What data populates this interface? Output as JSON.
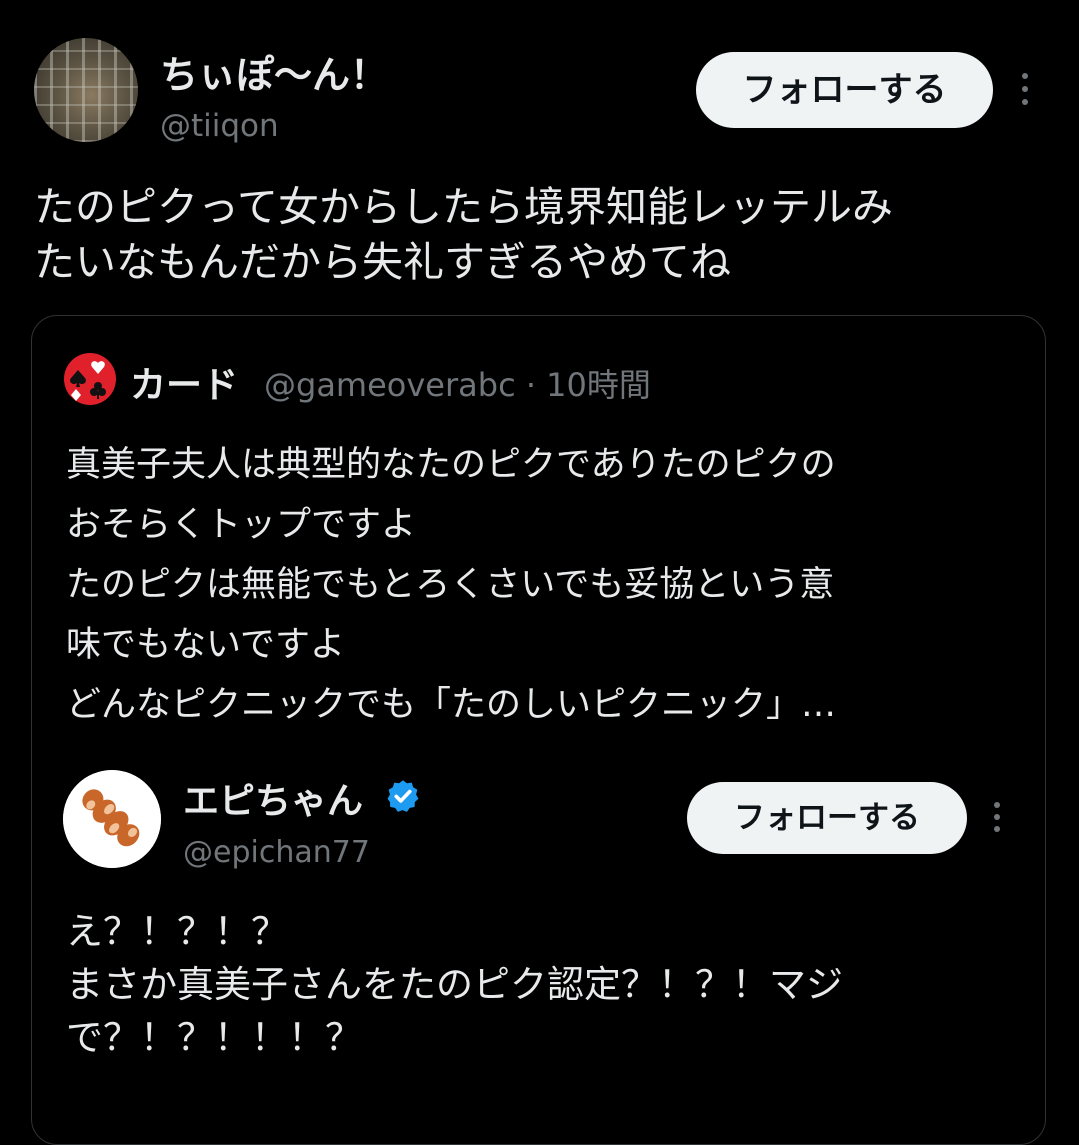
{
  "main_tweet": {
    "display_name": "ちぃぽ〜ん！",
    "handle": "@tiiqon",
    "follow_label": "フォローする",
    "text_lines": [
      "たのピクって女からしたら境界知能レッテルみ",
      "たいなもんだから失礼すぎるやめてね"
    ]
  },
  "quoted_tweet": {
    "display_name": "カード",
    "meta": "@gameoverabc · 10時間",
    "icon": "playing-card-suits-icon",
    "text_lines": [
      "真美子夫人は典型的なたのピクでありたのピクの",
      "おそらくトップですよ",
      "たのピクは無能でもとろくさいでも妥協という意",
      "味でもないですよ",
      "どんなピクニックでも「たのしいピクニック」…"
    ]
  },
  "nested_tweet": {
    "display_name": "エピちゃん",
    "handle": "@epichan77",
    "follow_label": "フォローする",
    "verified_icon": "verified-badge-icon",
    "text_lines": [
      "え？！？！？",
      "まさか真美子さんをたのピク認定？！？！マジ",
      "で？！？！！！？"
    ]
  },
  "colors": {
    "background": "#000000",
    "text": "#e7e9ea",
    "muted": "#71767b",
    "button_bg": "#eff3f4",
    "button_text": "#0f1419",
    "verified": "#1d9bf0",
    "card_red": "#e0202a"
  }
}
